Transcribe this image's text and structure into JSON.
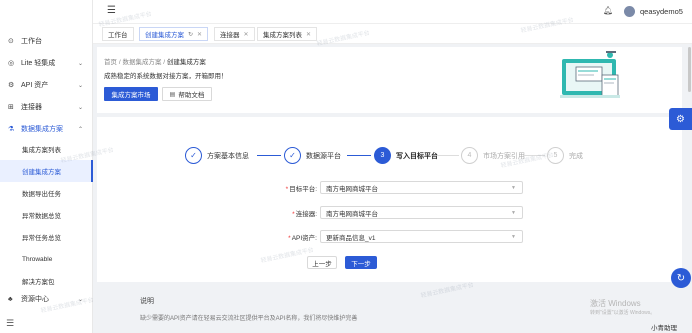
{
  "sidebar": {
    "items": [
      {
        "label": "工作台",
        "icon": "home-icon"
      },
      {
        "label": "Lite 轻集成",
        "icon": "lite-icon"
      },
      {
        "label": "API 资产",
        "icon": "api-icon"
      },
      {
        "label": "连接器",
        "icon": "connector-icon"
      },
      {
        "label": "数据集成方案",
        "icon": "integration-icon"
      },
      {
        "label": "资源中心",
        "icon": "resource-icon"
      }
    ],
    "sub_items": [
      "集成方案列表",
      "创建集成方案",
      "数据导出任务",
      "异常数据总览",
      "异常任务总览",
      "Throwable",
      "解决方案包"
    ]
  },
  "topbar": {
    "user": "qeasydemo5"
  },
  "tabs": [
    {
      "label": "工作台"
    },
    {
      "label": "创建集成方案"
    },
    {
      "label": "连接器"
    },
    {
      "label": "集成方案列表"
    }
  ],
  "header": {
    "breadcrumb": [
      "首页",
      "数据集成方案",
      "创建集成方案"
    ],
    "description": "成熟稳定的系统数据对接方案，开箱即用！",
    "market_button": "集成方案市场",
    "help_button": "帮助文档"
  },
  "steps": [
    {
      "label": "方案基本信息",
      "state": "done"
    },
    {
      "label": "数据源平台",
      "state": "done"
    },
    {
      "label": "写入目标平台",
      "state": "current",
      "number": "3"
    },
    {
      "label": "市场方案引用",
      "state": "wait",
      "number": "4"
    },
    {
      "label": "完成",
      "state": "wait",
      "number": "5"
    }
  ],
  "form": {
    "target_platform_label": "目标平台:",
    "target_platform_value": "南方电网商城平台",
    "connector_label": "连接器:",
    "connector_value": "南方电网商城平台",
    "api_asset_label": "API资产:",
    "api_asset_value": "更新商品信息_v1",
    "prev_button": "上一步",
    "next_button": "下一步"
  },
  "description": {
    "title": "说明",
    "text": "缺少需要的API资产请在轻易云交流社区提供平台及API名称，我们将尽快维护完善"
  },
  "windows_activation": {
    "title": "激活 Windows",
    "subtitle": "转到\"设置\"以激活 Windows。"
  },
  "assistant_label": "小青助理",
  "watermark": "轻易云数据集成平台",
  "colors": {
    "accent": "#2c5bd6",
    "required": "#e33333"
  }
}
